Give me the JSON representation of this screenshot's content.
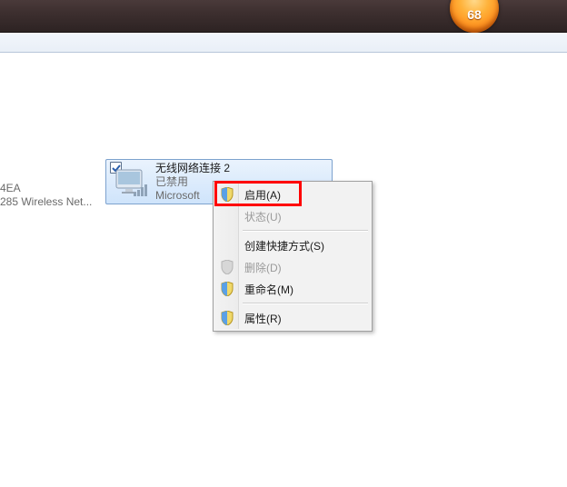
{
  "badge": {
    "value": "68"
  },
  "left_fragment": {
    "line1": "4EA",
    "line2": "285 Wireless Net..."
  },
  "adapter": {
    "title": "无线网络连接 2",
    "status": "已禁用",
    "device": "Microsoft",
    "checked": true
  },
  "menu": {
    "enable": "启用(A)",
    "status": "状态(U)",
    "shortcut": "创建快捷方式(S)",
    "delete": "删除(D)",
    "rename": "重命名(M)",
    "properties": "属性(R)"
  }
}
